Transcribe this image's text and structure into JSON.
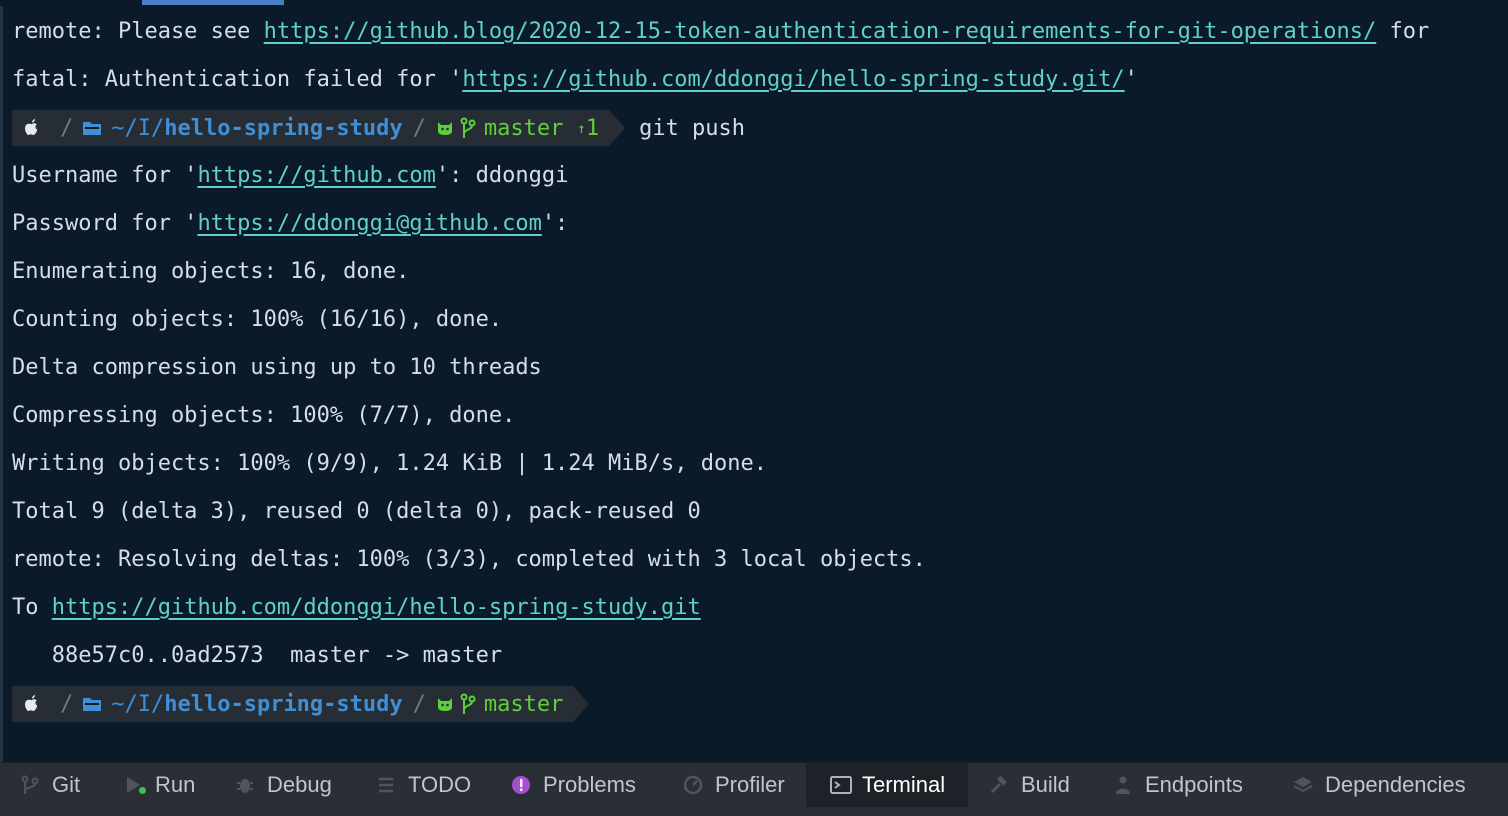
{
  "terminal": {
    "lines": {
      "l1_prefix": "remote: Please see ",
      "l1_link": "https://github.blog/2020-12-15-token-authentication-requirements-for-git-operations/",
      "l1_suffix": " for",
      "l2_prefix": "fatal: Authentication failed for '",
      "l2_link": "https://github.com/ddonggi/hello-spring-study.git/",
      "l2_suffix": "'",
      "l4_prefix": "Username for '",
      "l4_link": "https://github.com",
      "l4_suffix": "': ddonggi",
      "l5_prefix": "Password for '",
      "l5_link": "https://ddonggi@github.com",
      "l5_suffix": "':",
      "l6": "Enumerating objects: 16, done.",
      "l7": "Counting objects: 100% (16/16), done.",
      "l8": "Delta compression using up to 10 threads",
      "l9": "Compressing objects: 100% (7/7), done.",
      "l10": "Writing objects: 100% (9/9), 1.24 KiB | 1.24 MiB/s, done.",
      "l11": "Total 9 (delta 3), reused 0 (delta 0), pack-reused 0",
      "l12": "remote: Resolving deltas: 100% (3/3), completed with 3 local objects.",
      "l13_prefix": "To ",
      "l13_link": "https://github.com/ddonggi/hello-spring-study.git",
      "l14": "   88e57c0..0ad2573  master -> master"
    },
    "prompt1": {
      "path_dim": "~/I/",
      "path_strong": "hello-spring-study",
      "branch": "master",
      "ahead": "1",
      "ahead_arrow": "↑",
      "command": "git push"
    },
    "prompt2": {
      "path_dim": "~/I/",
      "path_strong": "hello-spring-study",
      "branch": "master"
    },
    "separator": "/"
  },
  "toolwindows": [
    {
      "label": "Git",
      "icon": "git-branch-icon"
    },
    {
      "label": "Run",
      "icon": "run-icon"
    },
    {
      "label": "Debug",
      "icon": "bug-icon"
    },
    {
      "label": "TODO",
      "icon": "list-icon"
    },
    {
      "label": "Problems",
      "icon": "alert-icon"
    },
    {
      "label": "Profiler",
      "icon": "gauge-icon"
    },
    {
      "label": "Terminal",
      "icon": "terminal-icon"
    },
    {
      "label": "Build",
      "icon": "hammer-icon"
    },
    {
      "label": "Endpoints",
      "icon": "endpoints-icon"
    },
    {
      "label": "Dependencies",
      "icon": "layers-icon"
    }
  ],
  "colors": {
    "background": "#0b1a29",
    "text": "#d7dde4",
    "link": "#5fd1c9",
    "path": "#3f8fd6",
    "branch": "#5fd03a",
    "toolbar": "#2a2f36",
    "problems_accent": "#a34fd0"
  }
}
